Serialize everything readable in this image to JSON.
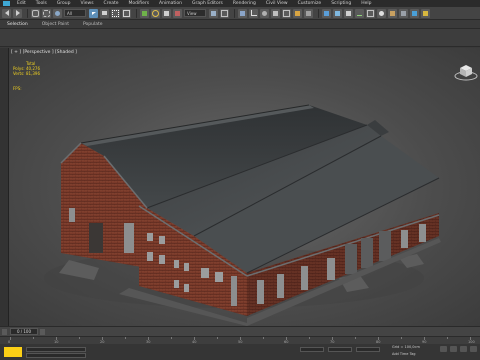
{
  "menubar": {
    "items": [
      "Edit",
      "Tools",
      "Group",
      "Views",
      "Create",
      "Modifiers",
      "Animation",
      "Graph Editors",
      "Rendering",
      "Civil View",
      "Customize",
      "Scripting",
      "Help"
    ]
  },
  "toolbar": {
    "selection_filter": "All",
    "view_dropdown": "View"
  },
  "ribbon": {
    "tabs": [
      "Selection",
      "Object Paint",
      "Populate"
    ]
  },
  "viewport": {
    "label": "[ + ] [Perspective ] [Shaded ]",
    "stats": {
      "header": "Total",
      "rows": [
        {
          "key": "Polys:",
          "value": "40,276"
        },
        {
          "key": "Verts:",
          "value": "81,396"
        }
      ],
      "fps_label": "FPS:"
    }
  },
  "timeline": {
    "frame": "0 / 100",
    "ticks": [
      "0",
      "10",
      "20",
      "30",
      "40",
      "50",
      "60",
      "70",
      "80",
      "90",
      "100"
    ]
  },
  "status": {
    "grid": "Grid = 100,0cm",
    "add_time_tag": "Add Time Tag"
  },
  "colors": {
    "accent": "#3fa9d6",
    "stats_yellow": "#f0d020",
    "key_yellow": "#fcd016",
    "brick": "#7a3a2a",
    "roof": "#3f4244"
  }
}
